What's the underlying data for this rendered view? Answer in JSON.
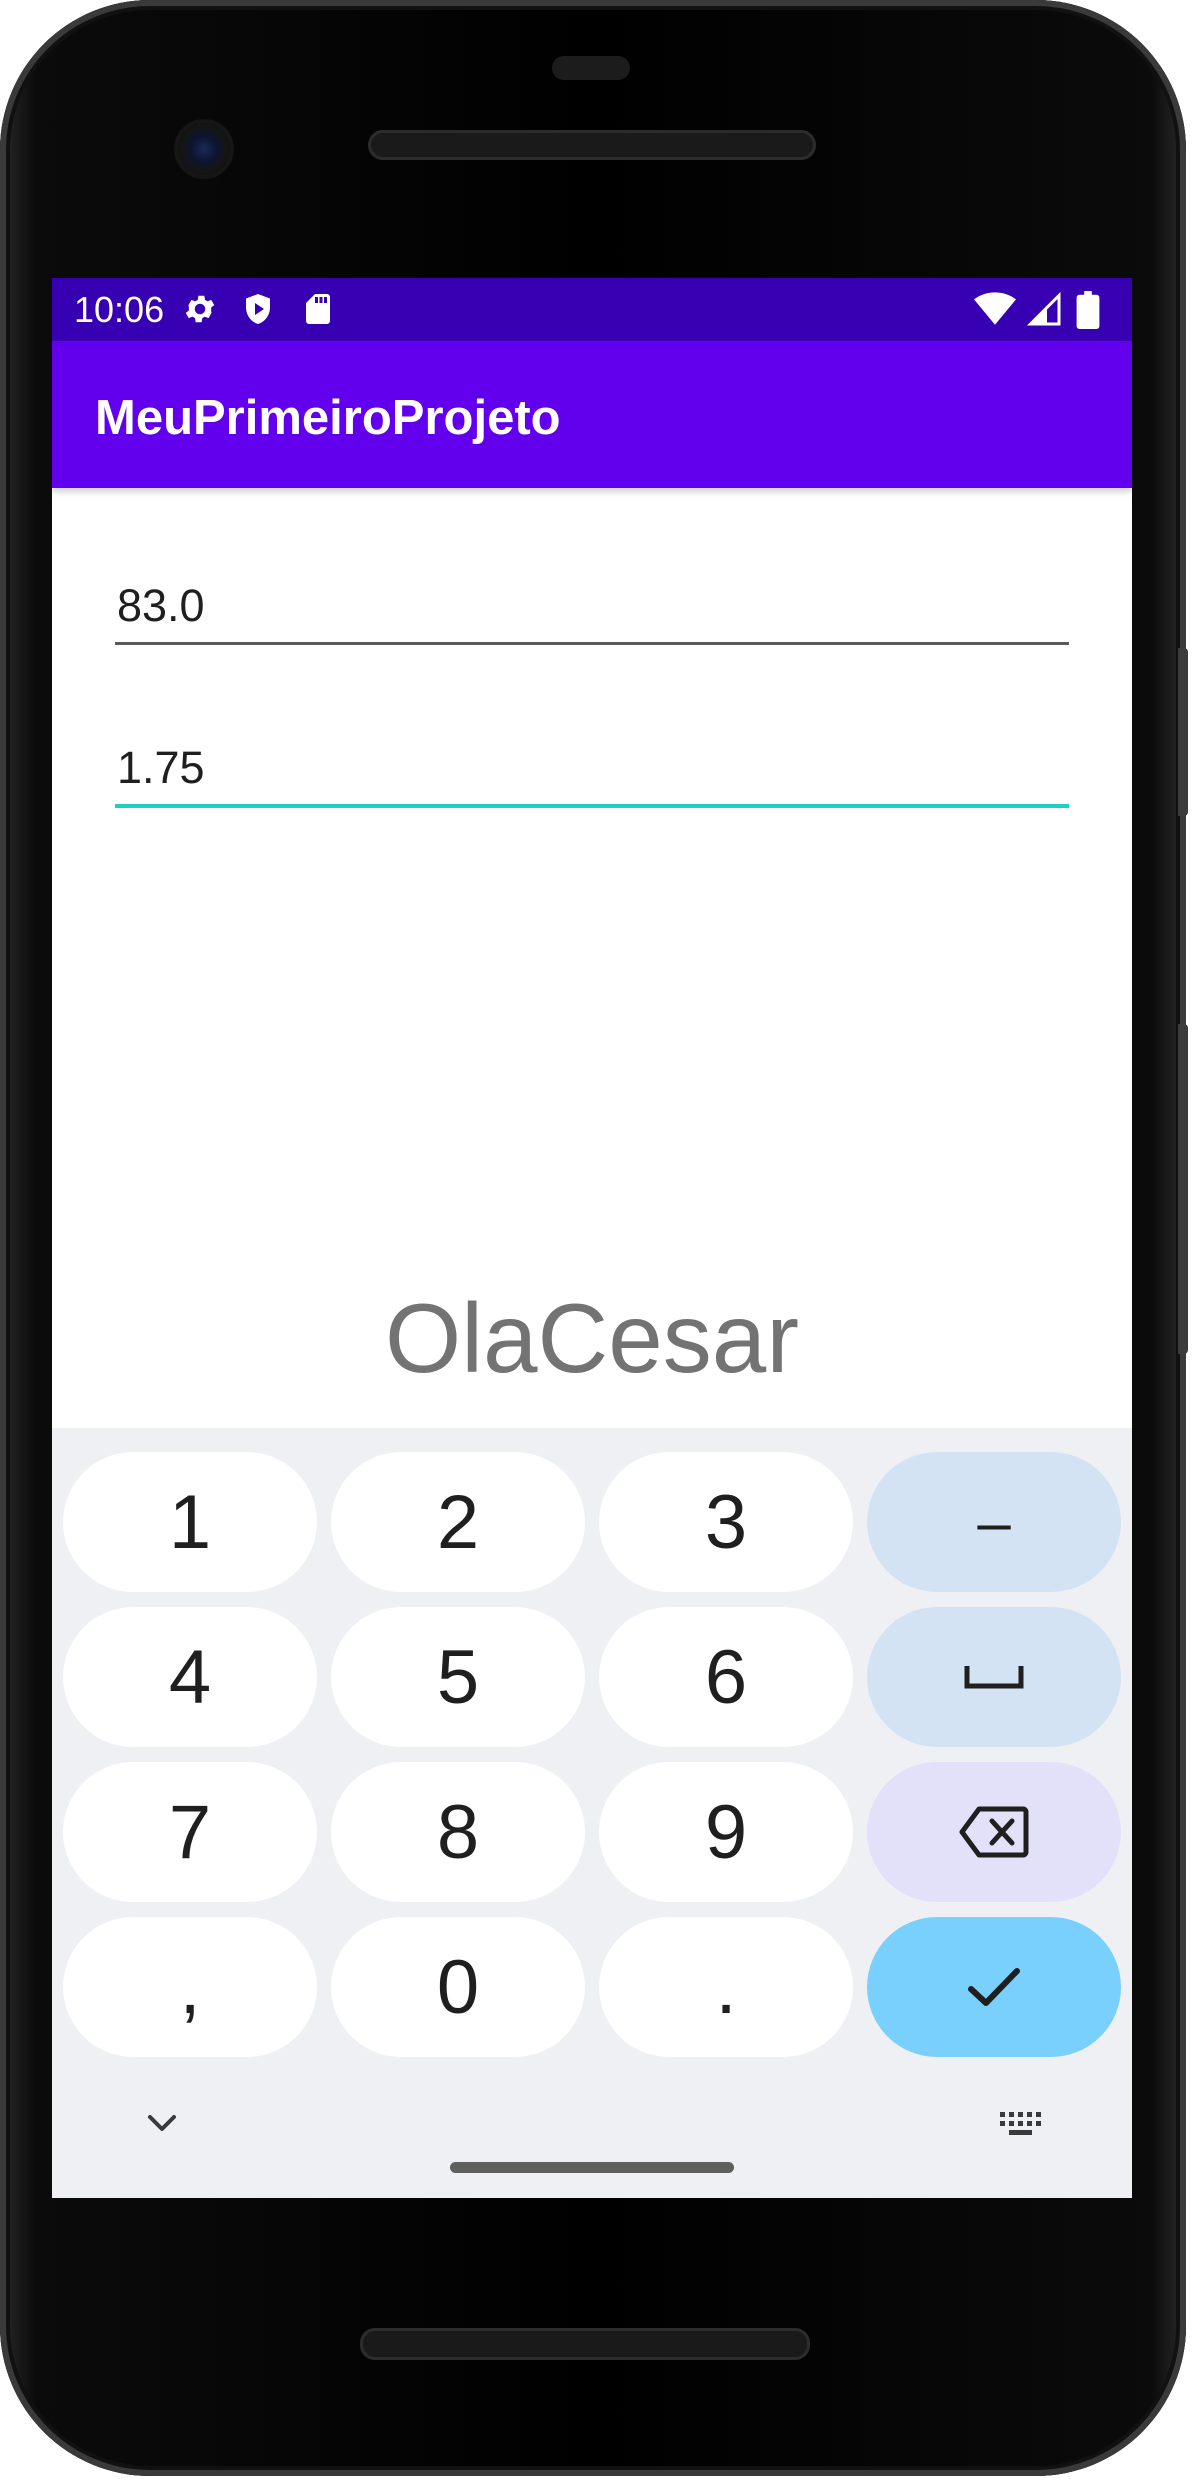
{
  "status_bar": {
    "time": "10:06",
    "left_icons": [
      "gear-icon",
      "shield-play-icon",
      "sd-card-icon"
    ],
    "right_icons": [
      "wifi-icon",
      "cell-signal-icon",
      "battery-icon"
    ],
    "color": "#3700b3"
  },
  "app_bar": {
    "title": "MeuPrimeiroProjeto",
    "color": "#6200ee"
  },
  "form": {
    "weight_value": "83.0",
    "height_value": "1.75",
    "focus_underline_color": "#1fcfc4"
  },
  "result": {
    "text": "OlaCesar"
  },
  "keyboard": {
    "rows": [
      [
        "1",
        "2",
        "3",
        "-"
      ],
      [
        "4",
        "5",
        "6",
        "space"
      ],
      [
        "7",
        "8",
        "9",
        "backspace"
      ],
      [
        ",",
        "0",
        ".",
        "done"
      ]
    ],
    "keys": {
      "k1": "1",
      "k2": "2",
      "k3": "3",
      "minus": "–",
      "k4": "4",
      "k5": "5",
      "k6": "6",
      "k7": "7",
      "k8": "8",
      "k9": "9",
      "comma": ",",
      "k0": "0",
      "period": "."
    },
    "icons": [
      "space-icon",
      "backspace-icon",
      "check-icon",
      "chevron-down-icon",
      "keyboard-icon"
    ],
    "colors": {
      "background": "#eff0f4",
      "key": "#ffffff",
      "function_key": "#d3e3f3",
      "delete_key": "#e3e0fa",
      "done_key": "#7ad0fc"
    }
  }
}
